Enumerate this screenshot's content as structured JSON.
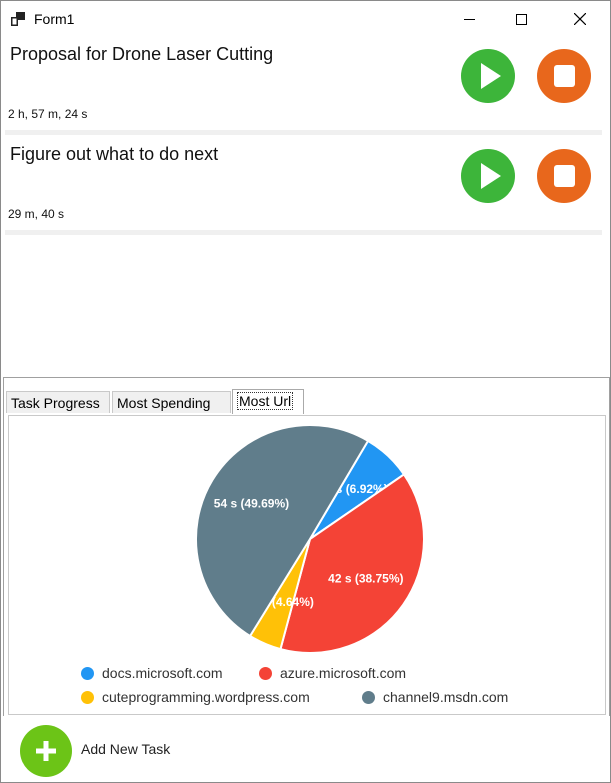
{
  "window": {
    "title": "Form1"
  },
  "tasks": [
    {
      "title": "Proposal for Drone Laser Cutting",
      "time": "2 h, 57 m, 24 s"
    },
    {
      "title": "Figure out what to do next",
      "time": "29 m, 40 s"
    }
  ],
  "tabs": [
    {
      "label": "Task Progress"
    },
    {
      "label": "Most Spending"
    },
    {
      "label": "Most Url"
    }
  ],
  "active_tab": "Most Url",
  "chart_data": {
    "type": "pie",
    "slices": [
      {
        "label": "docs.microsoft.com",
        "value_label": "7 s (6.92%)",
        "percent": 6.92,
        "color": "#2196f3"
      },
      {
        "label": "azure.microsoft.com",
        "value_label": "42 s (38.75%)",
        "percent": 38.75,
        "color": "#f44336"
      },
      {
        "label": "cuteprogramming.wordpress.com",
        "value_label": "5 s (4.64%)",
        "percent": 4.64,
        "color": "#ffc107"
      },
      {
        "label": "channel9.msdn.com",
        "value_label": "54 s (49.69%)",
        "percent": 49.69,
        "color": "#607d8b"
      }
    ],
    "legend_position": "bottom"
  },
  "footer": {
    "add_label": "Add New Task"
  },
  "colors": {
    "play": "#3db53a",
    "stop": "#e8671c",
    "add": "#6cc417"
  }
}
